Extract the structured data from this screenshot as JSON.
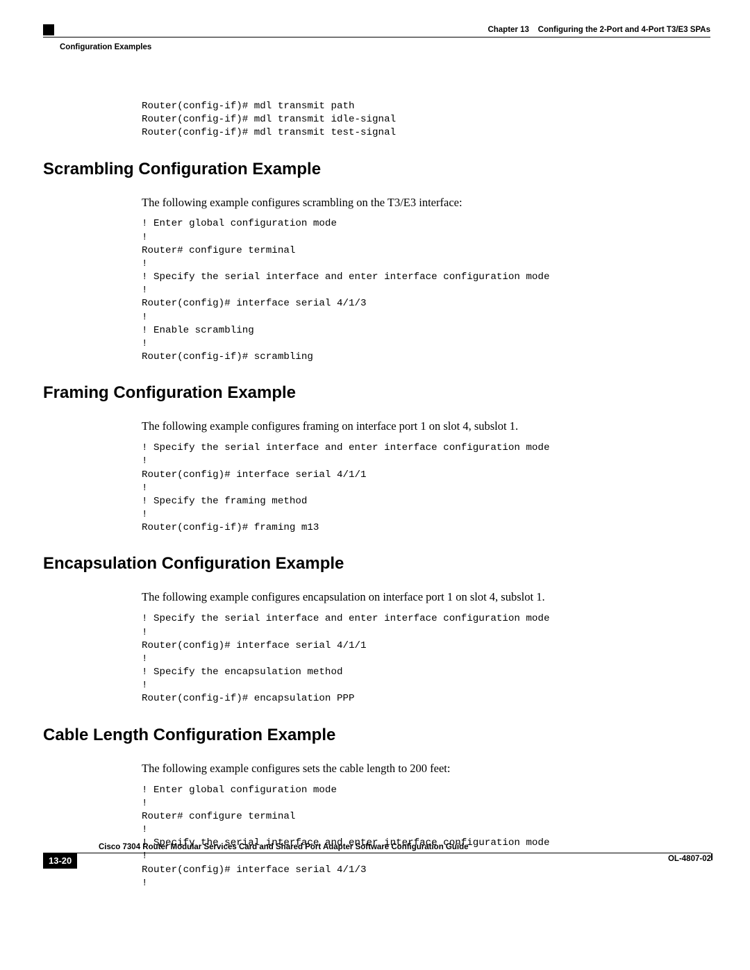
{
  "header": {
    "chapter_label": "Chapter 13",
    "chapter_title": "Configuring the 2-Port and 4-Port T3/E3 SPAs",
    "section": "Configuration Examples"
  },
  "intro_code": "Router(config-if)# mdl transmit path\nRouter(config-if)# mdl transmit idle-signal\nRouter(config-if)# mdl transmit test-signal",
  "sections": [
    {
      "heading": "Scrambling Configuration Example",
      "intro": "The following example configures scrambling on the T3/E3 interface:",
      "code": "! Enter global configuration mode\n!\nRouter# configure terminal\n!\n! Specify the serial interface and enter interface configuration mode\n!\nRouter(config)# interface serial 4/1/3\n!\n! Enable scrambling\n!\nRouter(config-if)# scrambling"
    },
    {
      "heading": "Framing Configuration Example",
      "intro": "The following example configures framing on interface port 1 on slot 4, subslot 1.",
      "code": "! Specify the serial interface and enter interface configuration mode\n!\nRouter(config)# interface serial 4/1/1\n!\n! Specify the framing method\n!\nRouter(config-if)# framing m13"
    },
    {
      "heading": "Encapsulation Configuration Example",
      "intro": "The following example configures encapsulation on interface port 1 on slot 4, subslot 1.",
      "code": "! Specify the serial interface and enter interface configuration mode\n!\nRouter(config)# interface serial 4/1/1\n!\n! Specify the encapsulation method\n!\nRouter(config-if)# encapsulation PPP"
    },
    {
      "heading": "Cable Length Configuration Example",
      "intro": "The following example configures sets the cable length to 200 feet:",
      "code": "! Enter global configuration mode\n!\nRouter# configure terminal\n!\n! Specify the serial interface and enter interface configuration mode\n!\nRouter(config)# interface serial 4/1/3\n!"
    }
  ],
  "footer": {
    "doc_title": "Cisco 7304 Router Modular Services Card and Shared Port Adapter Software Configuration Guide",
    "page_num": "13-20",
    "doc_id": "OL-4807-02"
  }
}
